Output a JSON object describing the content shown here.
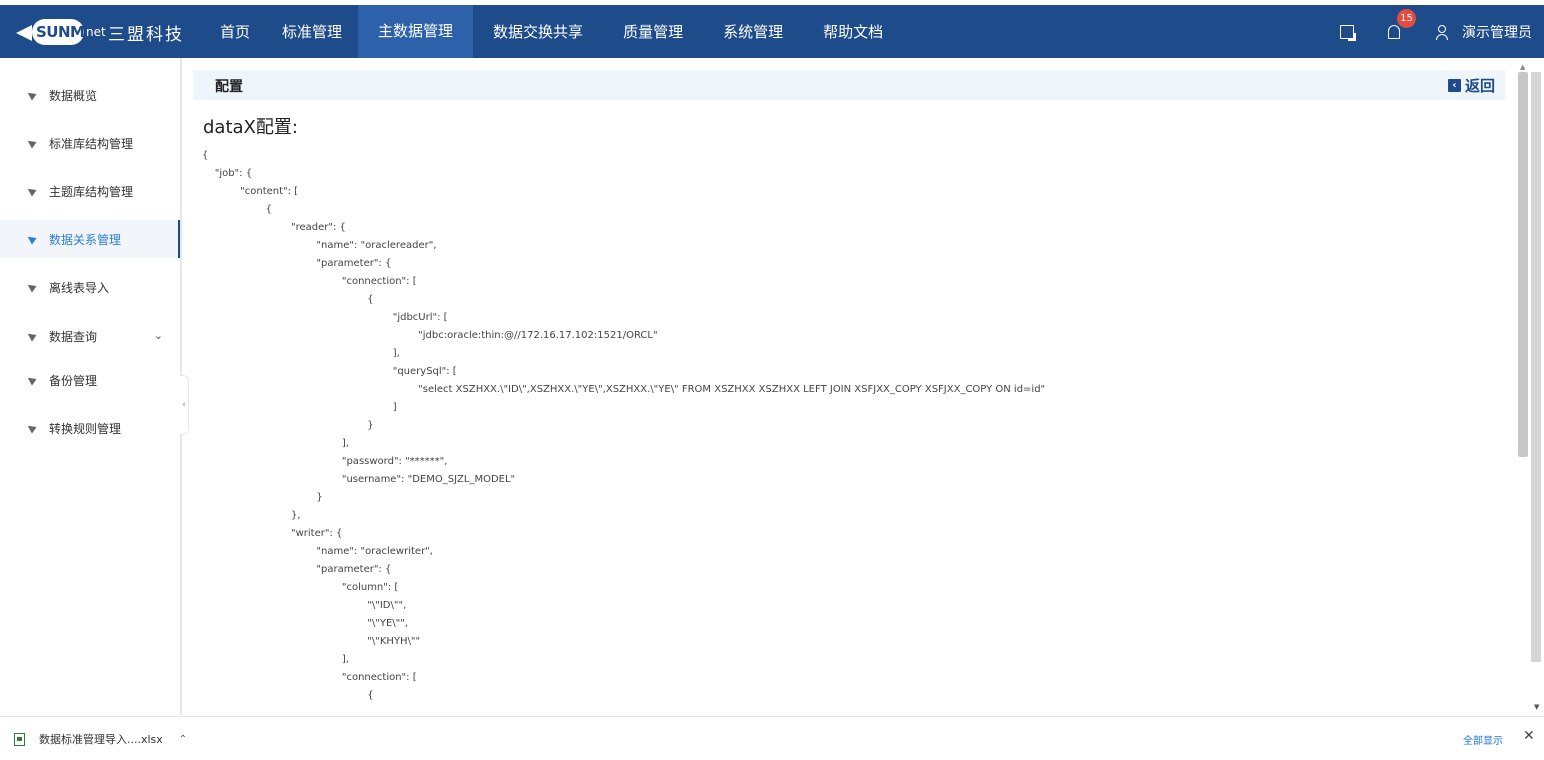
{
  "header": {
    "logo_text": "三盟科技",
    "logo_sun": "SUNM",
    "logo_net": "net",
    "nav": [
      {
        "label": "首页"
      },
      {
        "label": "标准管理"
      },
      {
        "label": "主数据管理"
      },
      {
        "label": "数据交换共享"
      },
      {
        "label": "质量管理"
      },
      {
        "label": "系统管理"
      },
      {
        "label": "帮助文档"
      }
    ],
    "active_nav": "主数据管理",
    "notification_count": "15",
    "user_name": "演示管理员"
  },
  "sidebar": {
    "items": [
      {
        "label": "数据概览"
      },
      {
        "label": "标准库结构管理"
      },
      {
        "label": "主题库结构管理"
      },
      {
        "label": "数据关系管理"
      },
      {
        "label": "离线表导入"
      },
      {
        "label": "数据查询"
      },
      {
        "label": "备份管理"
      },
      {
        "label": "转换规则管理"
      }
    ],
    "active_item": "数据关系管理"
  },
  "main": {
    "breadcrumb_title": "配置",
    "back_label": "返回",
    "section_title": "dataX配置:",
    "code_lines": [
      "{",
      "    \"job\": {",
      "            \"content\": [",
      "                    {",
      "                            \"reader\": {",
      "                                    \"name\": \"oraclereader\",",
      "                                    \"parameter\": {",
      "                                            \"connection\": [",
      "                                                    {",
      "                                                            \"jdbcUrl\": [",
      "                                                                    \"jdbc:oracle:thin:@//172.16.17.102:1521/ORCL\"",
      "                                                            ],",
      "                                                            \"querySql\": [",
      "                                                                    \"select XSZHXX.\\\"ID\\\",XSZHXX.\\\"YE\\\",XSZHXX.\\\"YE\\\" FROM XSZHXX XSZHXX LEFT JOIN XSFJXX_COPY XSFJXX_COPY ON id=id\"",
      "                                                            ]",
      "                                                    }",
      "                                            ],",
      "                                            \"password\": \"******\",",
      "                                            \"username\": \"DEMO_SJZL_MODEL\"",
      "                                    }",
      "                            },",
      "                            \"writer\": {",
      "                                    \"name\": \"oraclewriter\",",
      "                                    \"parameter\": {",
      "                                            \"column\": [",
      "                                                    \"\\\"ID\\\"\",",
      "                                                    \"\\\"YE\\\"\",",
      "                                                    \"\\\"KHYH\\\"\"",
      "                                            ],",
      "                                            \"connection\": [",
      "                                                    {"
    ]
  },
  "download_bar": {
    "file_name": "数据标准管理导入....xlsx",
    "show_all": "全部显示"
  },
  "colors": {
    "header_bg": "#1e4b8a",
    "active_nav_bg": "#2d62ab",
    "accent_blue": "#2d7fd6",
    "badge_red": "#e34c3e",
    "crumb_bg": "#eef6fc"
  }
}
